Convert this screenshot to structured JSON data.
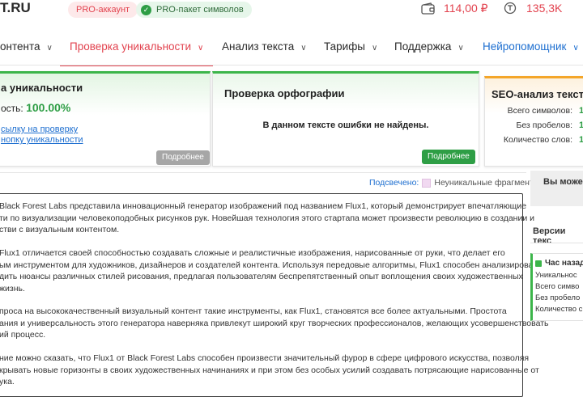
{
  "header": {
    "logo": "T.RU",
    "pro_account": "PRO-аккаунт",
    "pro_symbols": "PRO-пакет символов",
    "balance": "114,00 ₽",
    "coins": "135,3K"
  },
  "nav": {
    "items": [
      {
        "label": "онтента"
      },
      {
        "label": "Проверка уникальности"
      },
      {
        "label": "Анализ текста"
      },
      {
        "label": "Тарифы"
      },
      {
        "label": "Поддержка"
      },
      {
        "label": "Нейропомощник"
      }
    ]
  },
  "card_uniqueness": {
    "title": "а уникальности",
    "row_label": "ость:",
    "value": "100.00%",
    "link1": "сылку на проверку",
    "link2": "нопку уникальности",
    "button": "Подробнее"
  },
  "card_spelling": {
    "title": "Проверка орфографии",
    "message": "В данном тексте ошибки не найдены.",
    "button": "Подробнее"
  },
  "card_seo": {
    "title": "SEO-анализ текста",
    "rows": [
      {
        "label": "Всего символов:",
        "value": "1"
      },
      {
        "label": "Без пробелов:",
        "value": "1"
      },
      {
        "label": "Количество слов:",
        "value": "1"
      }
    ]
  },
  "highlight": {
    "label": "Подсвечено:",
    "legend": "Неуникальные фрагменты"
  },
  "text": {
    "paragraphs": [
      [
        "Black Forest Labs представила инновационный генератор изображений под названием Flux1, который демонстрирует впечатляющие",
        "ти по визуализации человекоподобных рисунков рук. Новейшая технология этого стартапа может произвести революцию в создании и",
        "стви с визуальным контентом."
      ],
      [
        "Flux1 отличается своей способностью создавать сложные и реалистичные изображения, нарисованные от руки, что делает его",
        "ым инструментом для художников, дизайнеров и создателей контента. Используя передовые алгоритмы, Flux1 способен анализировать и",
        "дить нюансы различных стилей рисования, предлагая пользователям беспрепятственный опыт воплощения своих художественных",
        "жизнь."
      ],
      [
        "проса на высококачественный визуальный контент такие инструменты, как Flux1, становятся все более актуальными. Простота",
        "ания и универсальность этого генератора наверняка привлекут широкий круг творческих профессионалов, желающих усовершенствовать",
        "ий процесс."
      ],
      [
        "ние можно сказать, что Flux1 от Black Forest Labs способен произвести значительный фурор в сфере цифрового искусства, позволяя",
        "крывать новые горизонты в своих художественных начинаниях и при этом без особых усилий создавать потрясающие нарисованные от",
        "ука."
      ]
    ]
  },
  "sidebar": {
    "box1_title": "Вы може",
    "versions_title": "Версии текс",
    "version": {
      "title": "Час назад",
      "rows": [
        "Уникальнос",
        "Всего симво",
        "Без пробело",
        "Количество с"
      ]
    }
  },
  "colors": {
    "accent_red": "#e2434f",
    "success_green": "#2e9e45",
    "link_blue": "#1e6fd0",
    "seo_orange": "#f4a62a"
  },
  "icons": [
    "check-icon",
    "wallet-icon",
    "coin-icon",
    "chevron-down-icon",
    "lock-icon"
  ]
}
